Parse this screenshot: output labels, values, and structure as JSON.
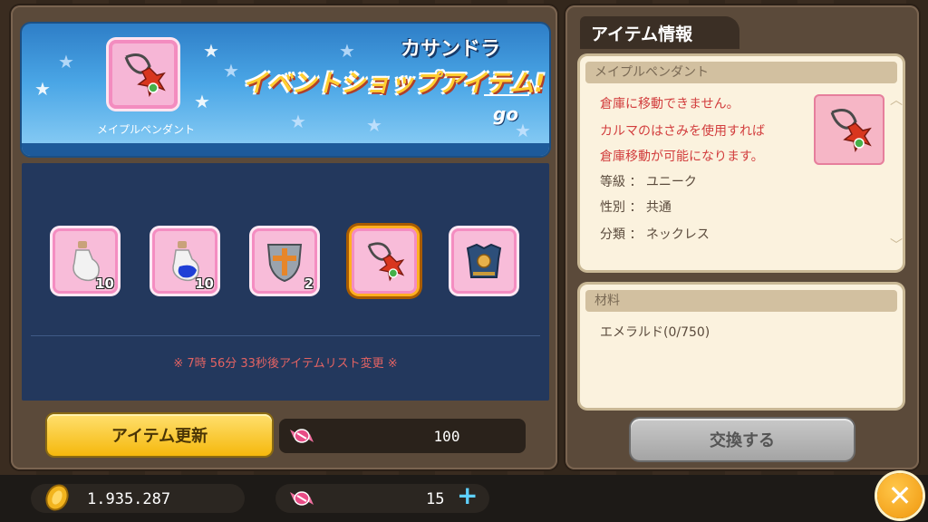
{
  "banner": {
    "featured_item_name": "メイプルペンダント",
    "subtitle": "カサンドラ",
    "title": "イベントショップアイテム!",
    "go_label": "go"
  },
  "shop": {
    "slots": [
      {
        "icon": "empty-potion-bottle-icon",
        "qty": "10"
      },
      {
        "icon": "blue-potion-bottle-icon",
        "qty": "10"
      },
      {
        "icon": "cross-shield-icon",
        "qty": "2"
      },
      {
        "icon": "maple-pendant-icon",
        "qty": ""
      },
      {
        "icon": "armor-chestplate-icon",
        "qty": ""
      }
    ],
    "selected_index": 3,
    "timer_text": "※ 7時 56分 33秒後アイテムリスト変更 ※"
  },
  "controls": {
    "refresh_label": "アイテム更新",
    "cost_value": "100",
    "exchange_label": "交換する"
  },
  "info": {
    "tab_label": "アイテム情報",
    "item_name": "メイプルペンダント",
    "desc_line1": "倉庫に移動できません。",
    "desc_line2": "カルマのはさみを使用すれば",
    "desc_line3": "倉庫移動が可能になります。",
    "grade": "等級 ： ユニーク",
    "gender": "性別 ： 共通",
    "category": "分類 ： ネックレス"
  },
  "materials": {
    "header": "材料",
    "item": "エメラルド(0/750)"
  },
  "status": {
    "gold": "1.935.287",
    "candy": "15"
  },
  "colors": {
    "selected_outline": "#ffb020",
    "slot_bg": "#f8bcd9",
    "timer": "#e36363",
    "refresh_button": "#f5b80d",
    "exchange_button_disabled": "#a4a4a4"
  }
}
